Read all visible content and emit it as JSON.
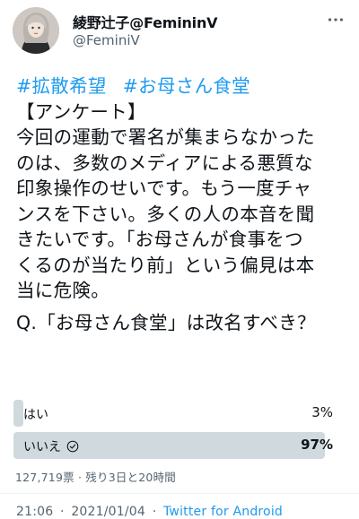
{
  "user": {
    "display_name": "綾野辻子@FemininV",
    "handle": "@FeminiV",
    "avatar_icon": "profile-photo"
  },
  "more_icon": "more-options-icon",
  "tweet": {
    "hashtags": [
      "#拡散希望",
      "#お母さん食堂"
    ],
    "lines": [
      "【アンケート】",
      "今回の運動で署名が集まらなかった",
      "のは、多数のメディアによる悪質な",
      "印象操作のせいです。もう一度チャ",
      "ンスを下さい。多くの人の本音を聞",
      "きたいです。「お母さんが食事をつ",
      "くるのが当たり前」という偏見は本",
      "当に危険。"
    ],
    "question": "Q.「お母さん食堂」は改名すべき？"
  },
  "poll": {
    "options": [
      {
        "label": "はい",
        "percent": "3%",
        "value": 3,
        "winner": false
      },
      {
        "label": "いいえ",
        "percent": "97%",
        "value": 97,
        "winner": true
      }
    ],
    "meta": "127,719票 · 残り3日と20時間"
  },
  "footer": {
    "time": "21:06",
    "separator": "·",
    "date": "2021/01/04",
    "source": "Twitter for Android"
  },
  "colors": {
    "accent": "#1d9bf0",
    "text": "#0f1419",
    "secondary": "#536471",
    "poll_bar": "#cfd9de"
  }
}
